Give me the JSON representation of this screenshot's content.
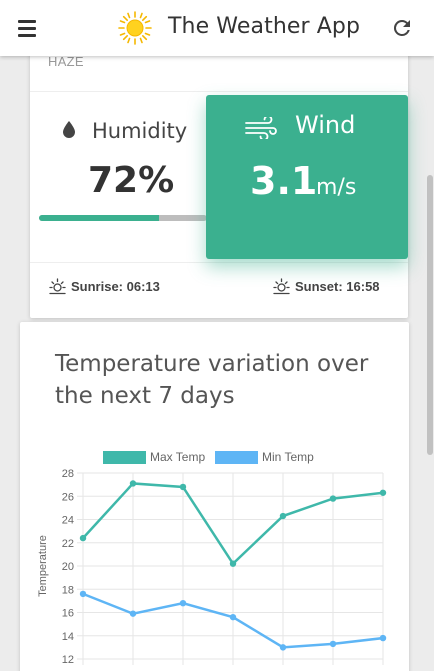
{
  "appbar": {
    "title": "The Weather App",
    "menu_icon": "menu-icon",
    "logo_icon": "sun-logo-icon",
    "refresh_icon": "refresh-icon"
  },
  "weather": {
    "condition": "HAZE",
    "humidity": {
      "label": "Humidity",
      "value": "72%",
      "fraction": 0.72
    },
    "wind": {
      "label": "Wind",
      "value": "3.1",
      "unit": "m/s"
    },
    "sunrise": "Sunrise: 06:13",
    "sunset": "Sunset: 16:58"
  },
  "colors": {
    "accent": "#3bb08f",
    "max_temp": "#3fb8aa",
    "min_temp": "#5eb5f5"
  },
  "chart_card": {
    "title": "Temperature variation over the next 7 days"
  },
  "chart_data": {
    "type": "line",
    "title": "Temperature variation over the next 7 days",
    "ylabel": "Temperature",
    "xlabel": "",
    "ylim": [
      12,
      28
    ],
    "yticks": [
      "28",
      "26",
      "24",
      "22",
      "20",
      "18",
      "16",
      "14",
      "12"
    ],
    "legend_position": "top",
    "grid": true,
    "series": [
      {
        "name": "Max Temp",
        "values": [
          22.4,
          27.1,
          26.8,
          20.2,
          24.3,
          25.8,
          26.3
        ]
      },
      {
        "name": "Min Temp",
        "values": [
          17.6,
          15.9,
          16.8,
          15.6,
          13.0,
          13.3,
          13.8
        ]
      }
    ]
  }
}
